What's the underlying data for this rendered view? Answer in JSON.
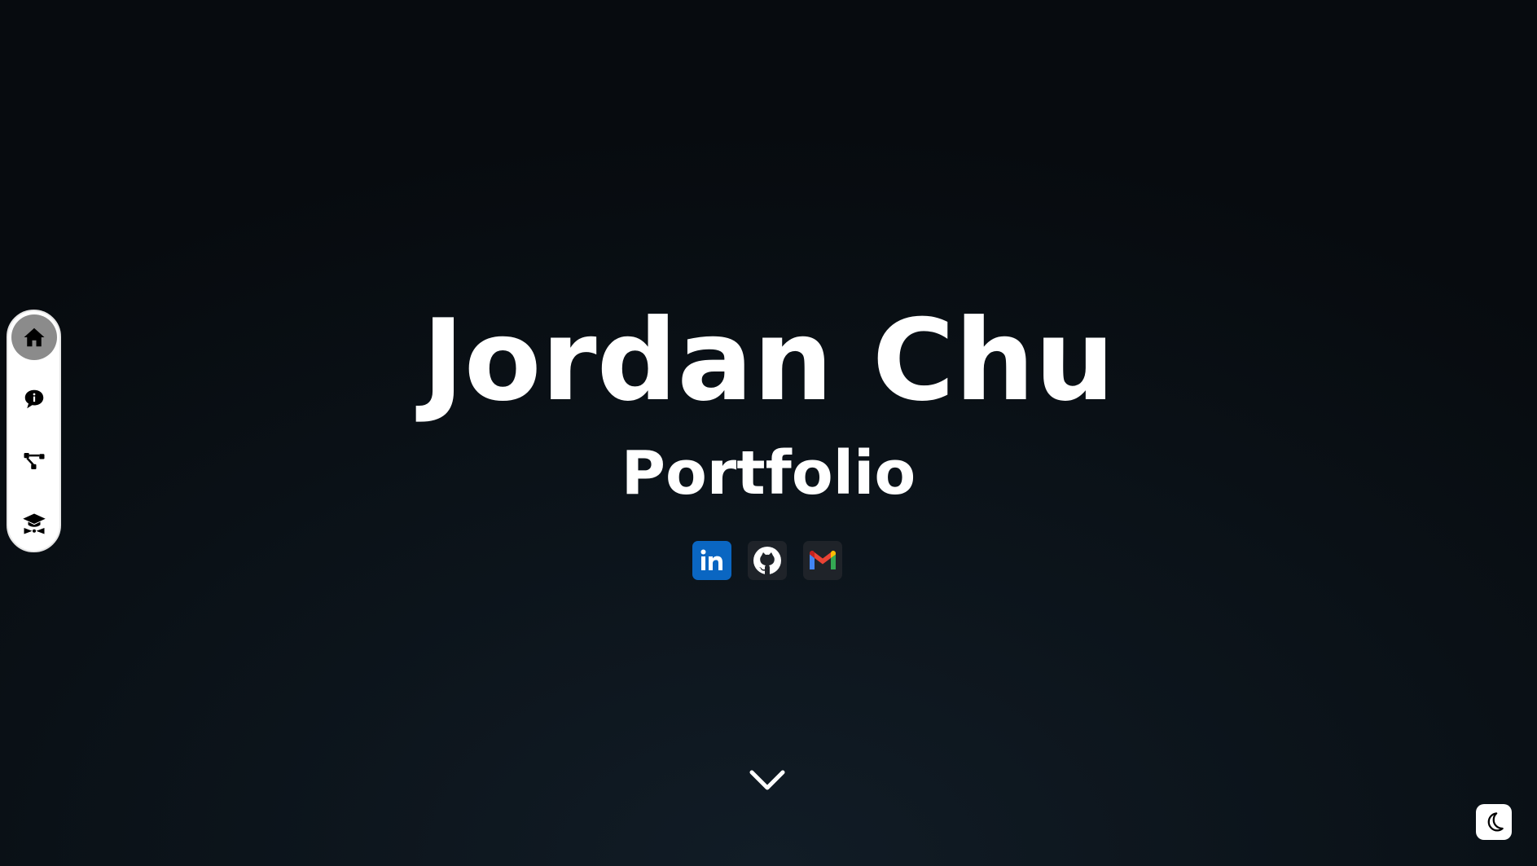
{
  "hero": {
    "name": "Jordan Chu",
    "subtitle": "Portfolio"
  },
  "sidebar": {
    "items": [
      {
        "icon": "home-icon",
        "active": true
      },
      {
        "icon": "info-chat-icon",
        "active": false
      },
      {
        "icon": "network-icon",
        "active": false
      },
      {
        "icon": "graduation-cap-icon",
        "active": false
      }
    ]
  },
  "social": [
    {
      "icon": "linkedin-icon",
      "color": "#0a66c2"
    },
    {
      "icon": "github-icon",
      "color": "#1f2329"
    },
    {
      "icon": "gmail-icon",
      "color": "#1f2329"
    }
  ],
  "controls": {
    "scroll_icon": "chevron-down-icon",
    "theme_icon": "moon-icon"
  },
  "colors": {
    "background": "#0c141b",
    "text": "#ffffff",
    "sidebar_bg": "#ffffff",
    "active_nav": "#8b8b8b",
    "linkedin": "#0a66c2"
  }
}
